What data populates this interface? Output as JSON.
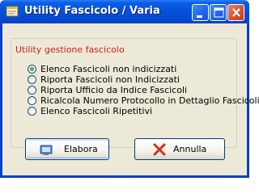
{
  "window": {
    "title": "Utility Fascicolo / Varia"
  },
  "group": {
    "title": "Utility gestione fascicolo"
  },
  "options": [
    {
      "label": "Elenco Fascicoli non indicizzati",
      "selected": true
    },
    {
      "label": "Riporta Fascicoli non Indicizzati",
      "selected": false
    },
    {
      "label": "Riporta Ufficio da Indice Fascicoli",
      "selected": false
    },
    {
      "label": "Ricalcola Numero Protocollo in Dettaglio Fascicoli",
      "selected": false
    },
    {
      "label": "Elenco Fascicoli Ripetitivi",
      "selected": false
    }
  ],
  "buttons": {
    "elabora_label": "Elabora",
    "annulla_label": "Annulla"
  },
  "colors": {
    "group_title": "#d4201a",
    "titlebar": "#0650d8",
    "radio_dot": "#21a121"
  }
}
